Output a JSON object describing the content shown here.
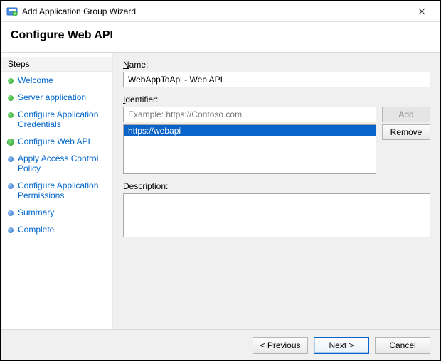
{
  "window": {
    "title": "Add Application Group Wizard"
  },
  "header": {
    "title": "Configure Web API"
  },
  "sidebar": {
    "title": "Steps",
    "items": [
      {
        "label": "Welcome",
        "state": "done"
      },
      {
        "label": "Server application",
        "state": "done"
      },
      {
        "label": "Configure Application Credentials",
        "state": "done"
      },
      {
        "label": "Configure Web API",
        "state": "current"
      },
      {
        "label": "Apply Access Control Policy",
        "state": "pending"
      },
      {
        "label": "Configure Application Permissions",
        "state": "pending"
      },
      {
        "label": "Summary",
        "state": "pending"
      },
      {
        "label": "Complete",
        "state": "pending"
      }
    ]
  },
  "form": {
    "name_label_pre": "N",
    "name_label_post": "ame:",
    "name_value": "WebAppToApi - Web API",
    "identifier_label_pre": "I",
    "identifier_label_post": "dentifier:",
    "identifier_placeholder": "Example: https://Contoso.com",
    "identifier_value": "",
    "add_button": "Add",
    "remove_button": "Remove",
    "identifier_list": [
      "https://webapi"
    ],
    "description_label_pre": "D",
    "description_label_post": "escription:",
    "description_value": ""
  },
  "footer": {
    "previous": "< Previous",
    "next": "Next >",
    "cancel": "Cancel"
  }
}
